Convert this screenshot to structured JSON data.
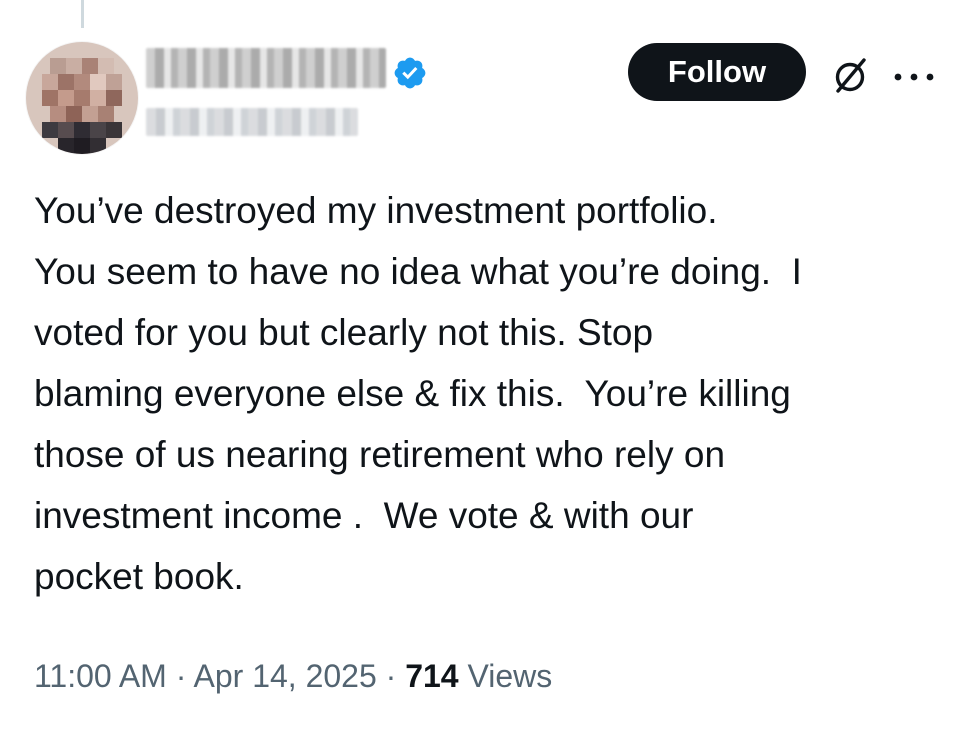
{
  "header": {
    "follow_label": "Follow",
    "verified_badge_color": "#1d9bf0",
    "follow_button_color": "#0f1419"
  },
  "icons": {
    "verified": "verified-badge-icon",
    "grok": "grok-icon",
    "more": "more-options-icon"
  },
  "tweet": {
    "lines": [
      "You’ve destroyed my investment portfolio.",
      "You seem to have no idea what you’re doing.  I",
      "voted for you but clearly not this. Stop",
      "blaming everyone else & fix this.  You’re killing",
      "those of us nearing retirement who rely on",
      "investment income .  We vote & with our",
      "pocket book."
    ]
  },
  "meta": {
    "time": "11:00 AM",
    "separator": " · ",
    "date": "Apr 14, 2025",
    "views_count": "714",
    "views_label": "Views"
  }
}
